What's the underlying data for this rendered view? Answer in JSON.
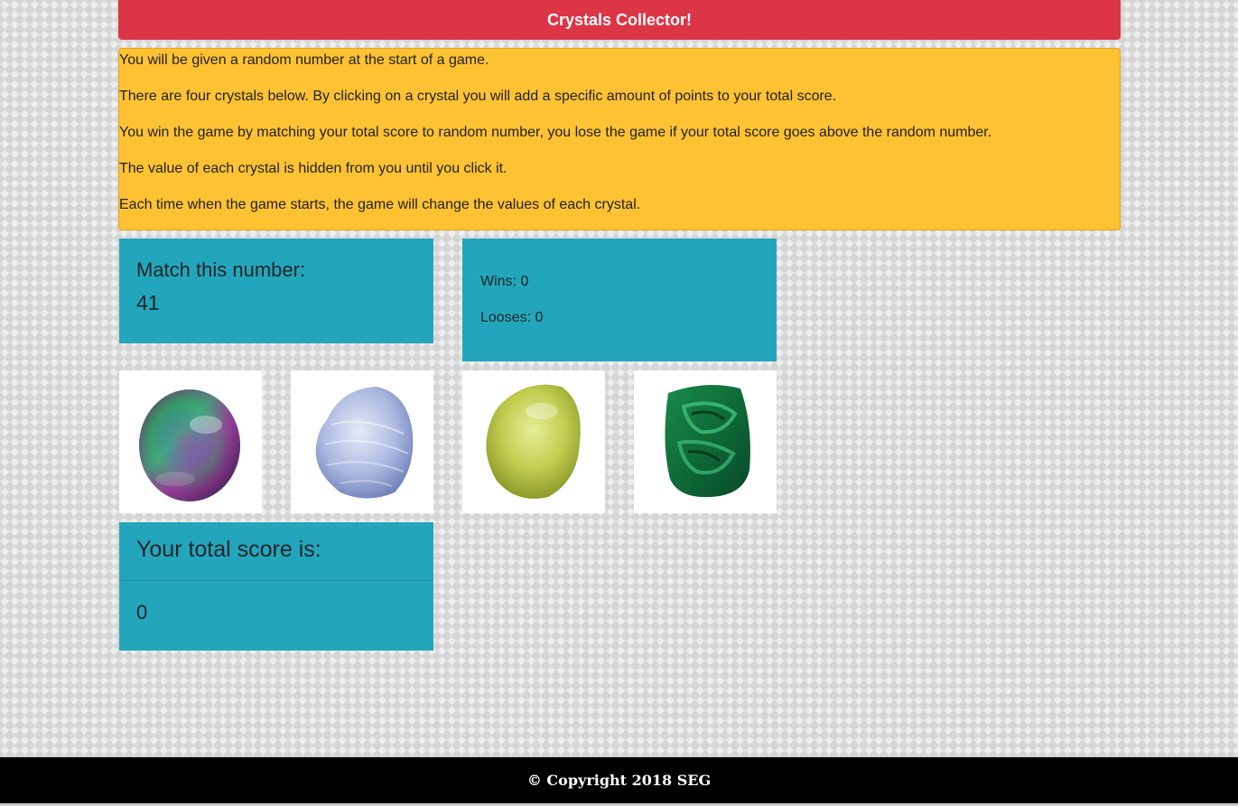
{
  "header": {
    "title": "Crystals Collector!"
  },
  "instructions": [
    "You will be given a random number at the start of a game.",
    "There are four crystals below. By clicking on a crystal you will add a specific amount of points to your total score.",
    "You win the game by matching your total score to random number, you lose the game if your total score goes above the random number.",
    "The value of each crystal is hidden from you until you click it.",
    "Each time when the game starts, the game will change the values of each crystal."
  ],
  "target": {
    "label": "Match this number:",
    "value": "41"
  },
  "stats": {
    "wins": "Wins: 0",
    "losses": "Looses: 0"
  },
  "crystals": [
    {
      "icon": "fluorite-crystal-icon"
    },
    {
      "icon": "blue-lace-agate-crystal-icon"
    },
    {
      "icon": "serpentine-crystal-icon"
    },
    {
      "icon": "malachite-crystal-icon"
    }
  ],
  "score": {
    "label": "Your total score is:",
    "value": "0"
  },
  "footer": {
    "text": "© Copyright 2018 SEG"
  },
  "colors": {
    "header": "#dc3545",
    "instructions": "#ffc233",
    "panel": "#23a6bb",
    "footer": "#000000"
  }
}
